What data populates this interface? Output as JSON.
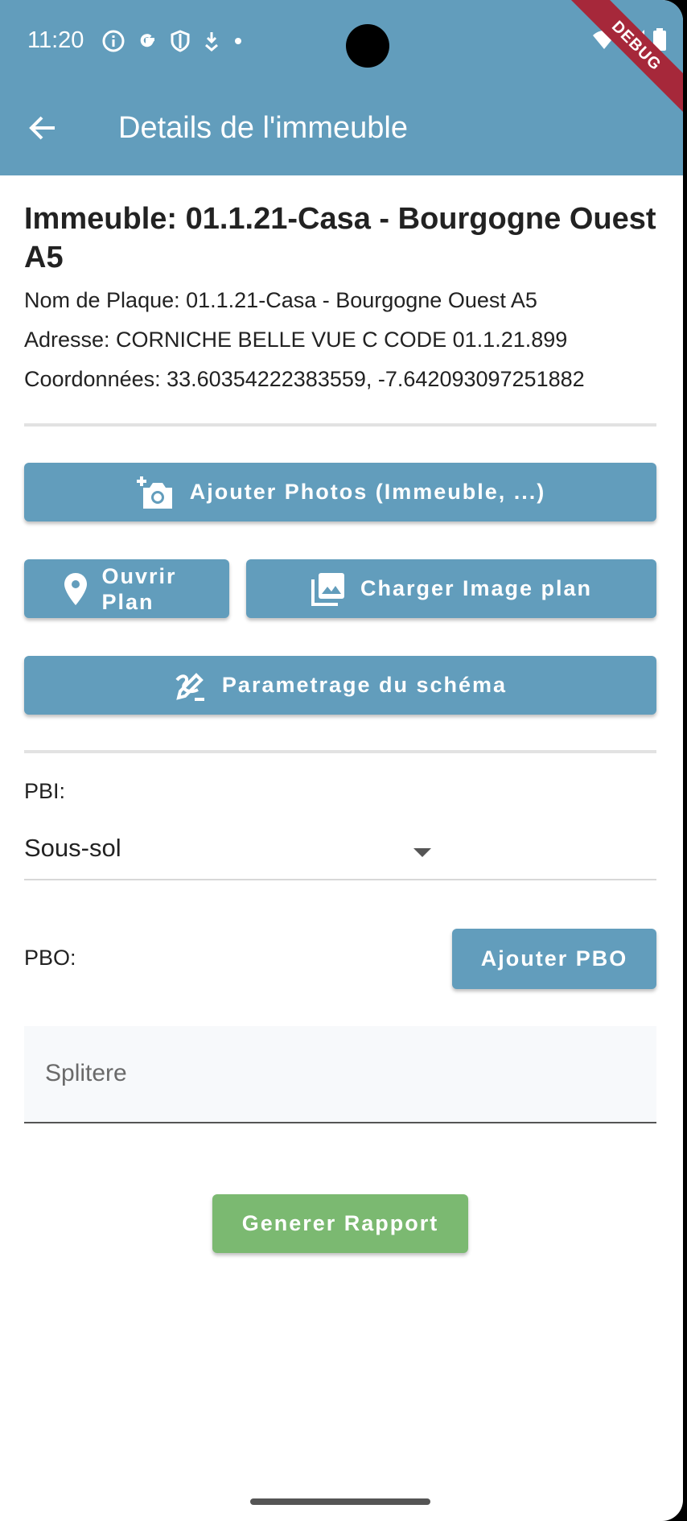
{
  "status_bar": {
    "time": "11:20"
  },
  "debug_banner": "DEBUG",
  "appbar": {
    "title": "Details de l'immeuble"
  },
  "building": {
    "heading": "Immeuble: 01.1.21-Casa - Bourgogne Ouest A5",
    "plate": "Nom de Plaque: 01.1.21-Casa - Bourgogne Ouest A5",
    "address": "Adresse: CORNICHE BELLE VUE C CODE 01.1.21.899",
    "coords": "Coordonnées: 33.60354222383559, -7.642093097251882"
  },
  "buttons": {
    "add_photos": "Ajouter Photos (Immeuble, ...)",
    "open_plan": "Ouvrir Plan",
    "load_plan_image": "Charger Image plan",
    "schema_settings": "Parametrage du schéma",
    "add_pbo": "Ajouter PBO",
    "generate_report": "Generer Rapport"
  },
  "pbi": {
    "label": "PBI:",
    "selected": "Sous-sol"
  },
  "pbo": {
    "label": "PBO:"
  },
  "splitter": {
    "placeholder": "Splitere"
  },
  "colors": {
    "primary": "#629DBC",
    "green": "#7BB971",
    "debug": "#A6283A"
  }
}
